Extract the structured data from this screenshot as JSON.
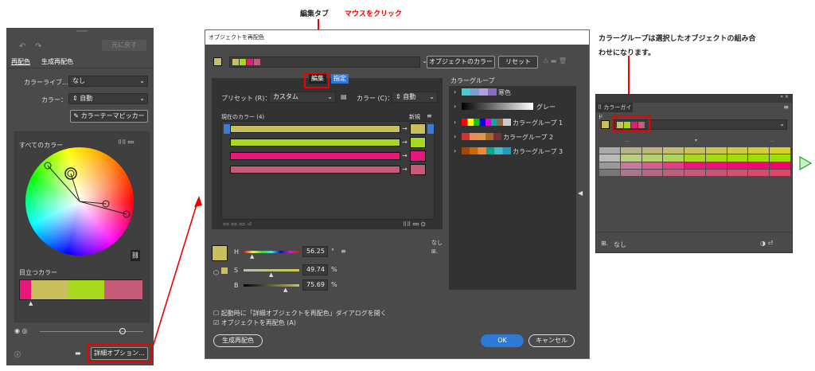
{
  "annotations": {
    "edit_tab_title": "編集タブ",
    "edit_tab_click": "マウスをクリック",
    "group_note_line1": "カラーグループは選択したオブジェクトの組み合",
    "group_note_line2": "わせになります。"
  },
  "left_panel": {
    "tabs": [
      "再配色",
      "生成再配色"
    ],
    "dimmed_button": "元に戻す",
    "library_label": "カラーライブ...",
    "library_value": "なし",
    "color_label": "カラー：",
    "color_value": "自動",
    "theme_picker": "カラーテーマピッカー",
    "all_colors": "すべてのカラー",
    "prominent": "目立つカラー",
    "adv_options": "詳細オプション..."
  },
  "dialog": {
    "title": "オブジェクトを再配色",
    "object_colors_btn": "オブジェクトのカラー",
    "reset_btn": "リセット",
    "tab_edit": "編集",
    "tab_assign": "指定",
    "preset_label": "プリセット (R)：",
    "preset_value": "カスタム",
    "colors_label": "カラー (C)：",
    "colors_value": "自動",
    "current_colors": "現在のカラー (4)",
    "new_label": "新規",
    "h_label": "H",
    "s_label": "S",
    "b_label": "B",
    "h_value": "56.25",
    "s_value": "49.74",
    "b_value": "75.69",
    "h_unit": "°",
    "s_unit": "%",
    "b_unit": "%",
    "none_label": "なし",
    "check1": "起動時に「詳細オブジェクトを再配色」ダイアログを開く",
    "check2": "オブジェクトを再配色 (A)",
    "gen_btn": "生成再配色",
    "ok_btn": "OK",
    "cancel_btn": "キャンセル",
    "color_groups_label": "カラーグループ",
    "groups": [
      "寒色",
      "グレー",
      "カラーグループ 1",
      "カラーグループ 2",
      "カラーグループ 3"
    ]
  },
  "guide_panel": {
    "title": "カラーガイド",
    "bottom_label": "なし"
  },
  "colors": {
    "khaki": "#c9bf5c",
    "lime": "#a8d81e",
    "pink": "#e8177c",
    "rose": "#c45c78",
    "red": "#e00000"
  }
}
